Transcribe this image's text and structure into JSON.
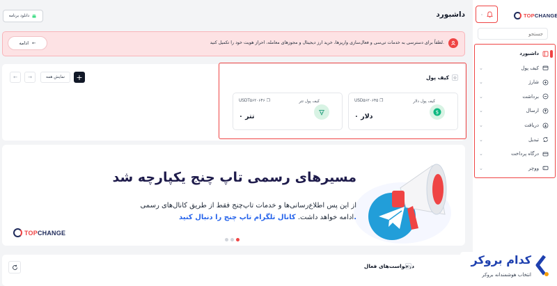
{
  "app": {
    "logo": {
      "part1": "TOP",
      "part2": "CHANGE"
    },
    "page_title": "داشبورد"
  },
  "header": {
    "notification_count": "۰",
    "download_label": "دانلود برنامه"
  },
  "sidebar": {
    "search_placeholder": "جستجو",
    "items": [
      {
        "label": "داشبورد",
        "icon": "dashboard-icon",
        "active": true,
        "expandable": false
      },
      {
        "label": "کیف پول",
        "icon": "wallet-icon",
        "active": false,
        "expandable": true
      },
      {
        "label": "شارژ",
        "icon": "plus-circle-icon",
        "active": false,
        "expandable": true
      },
      {
        "label": "برداشت",
        "icon": "minus-circle-icon",
        "active": false,
        "expandable": true
      },
      {
        "label": "ارسال",
        "icon": "send-icon",
        "active": false,
        "expandable": true
      },
      {
        "label": "دریافت",
        "icon": "receive-icon",
        "active": false,
        "expandable": true
      },
      {
        "label": "تبدیل",
        "icon": "convert-icon",
        "active": false,
        "expandable": true
      },
      {
        "label": "درگاه پرداخت",
        "icon": "card-icon",
        "active": false,
        "expandable": true
      },
      {
        "label": "ووچر",
        "icon": "voucher-icon",
        "active": false,
        "expandable": true
      }
    ]
  },
  "alert": {
    "text": "لطفاً برای دسترسی به خدمات تی‌سی و فعال‌سازی واریزها، خرید ارز دیجیتال و مجوزهای معامله، احراز هویت خود را تکمیل کنید.",
    "button_label": "ادامه"
  },
  "wallets": {
    "title": "کیف پول",
    "show_all_label": "نمایش همه",
    "cards": [
      {
        "label": "کیف پول دلار",
        "address": "USD۵۶۲۰۶۴۵",
        "amount": "۰ دلار",
        "coin_color": "#10b981"
      },
      {
        "label": "کیف پول تتر",
        "address": "USDT۵۶۲۰۶۴۶",
        "amount": "۰ تتر",
        "coin_color": "#26a17b"
      }
    ]
  },
  "banner": {
    "headline": "مسیرهای رسمی تاپ چنج یکپارچه شد",
    "line1": "از این پس اطلاع‌رسانی‌ها و خدمات تاپ‌چنج فقط از طریق کانال‌های رسمی",
    "line2_prefix": "ادامه خواهد داشت. ",
    "line2_highlight": "کانال تلگرام تاپ چنج را دنبال کنید.",
    "logo": {
      "part1": "TOP",
      "part2": "CHANGE"
    },
    "slides": 3,
    "active_slide": 1
  },
  "requests": {
    "title": "درخواست‌های فعال"
  },
  "watermark": {
    "title": "کدام بروکر",
    "subtitle": "انتخاب هوشمندانه بروکر"
  },
  "colors": {
    "accent": "#ef4444",
    "navy": "#1f2b5b",
    "link": "#2563eb"
  }
}
